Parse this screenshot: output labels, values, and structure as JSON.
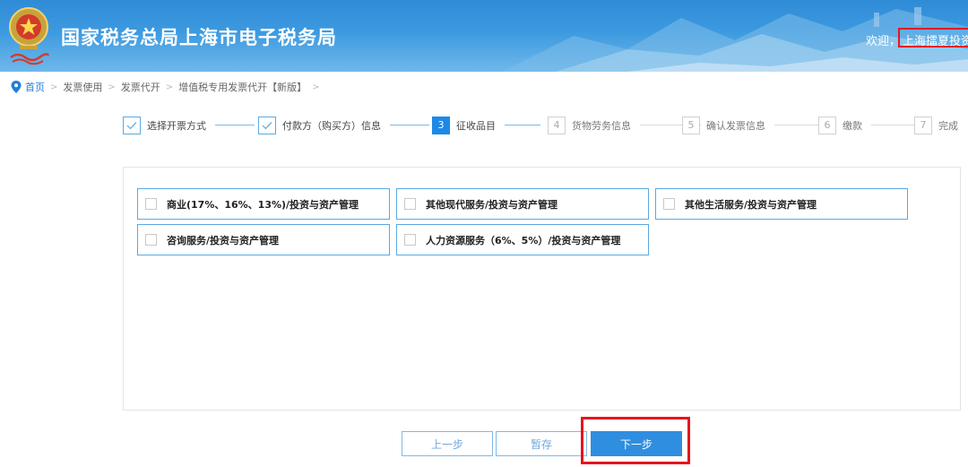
{
  "header": {
    "site_title": "国家税务总局上海市电子税务局",
    "welcome": "欢迎，",
    "user_name": "上海擂夏投资"
  },
  "breadcrumb": {
    "items": [
      "首页",
      "发票使用",
      "发票代开",
      "增值税专用发票代开【新版】"
    ]
  },
  "steps": [
    {
      "num": "1",
      "label": "选择开票方式",
      "state": "done"
    },
    {
      "num": "2",
      "label": "付款方（购买方）信息",
      "state": "done"
    },
    {
      "num": "3",
      "label": "征收品目",
      "state": "active"
    },
    {
      "num": "4",
      "label": "货物劳务信息",
      "state": "todo"
    },
    {
      "num": "5",
      "label": "确认发票信息",
      "state": "todo"
    },
    {
      "num": "6",
      "label": "缴款",
      "state": "todo"
    },
    {
      "num": "7",
      "label": "完成",
      "state": "todo"
    }
  ],
  "options": [
    {
      "label": "商业(17%、16%、13%)/投资与资产管理",
      "checked": false
    },
    {
      "label": "其他现代服务/投资与资产管理",
      "checked": false
    },
    {
      "label": "其他生活服务/投资与资产管理",
      "checked": false
    },
    {
      "label": "咨询服务/投资与资产管理",
      "checked": false
    },
    {
      "label": "人力资源服务（6%、5%）/投资与资产管理",
      "checked": false
    }
  ],
  "buttons": {
    "prev": "上一步",
    "save": "暂存",
    "next": "下一步"
  },
  "colors": {
    "accent": "#1e88e5",
    "highlight": "#e8141c"
  }
}
